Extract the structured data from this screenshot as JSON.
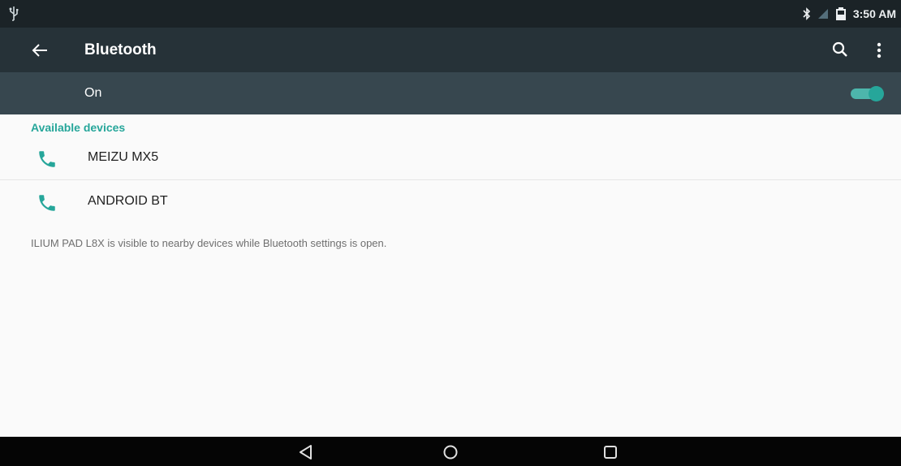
{
  "status_bar": {
    "time": "3:50 AM",
    "icons": [
      "usb-icon",
      "bluetooth-icon",
      "no-signal-icon",
      "battery-icon"
    ]
  },
  "toolbar": {
    "title": "Bluetooth",
    "icons": [
      "back-arrow-icon",
      "search-icon",
      "more-vert-icon"
    ]
  },
  "master_switch": {
    "label": "On",
    "state": "on",
    "accent_color": "#26a69a"
  },
  "available_devices": {
    "header": "Available devices",
    "items": [
      {
        "name": "MEIZU MX5",
        "icon": "phone-icon"
      },
      {
        "name": "ANDROID BT",
        "icon": "phone-icon"
      }
    ]
  },
  "footer_note": "ILIUM PAD L8X is visible to nearby devices while Bluetooth settings is open.",
  "nav_bar": {
    "icons": [
      "back-triangle-icon",
      "home-circle-icon",
      "recents-square-icon"
    ]
  },
  "colors": {
    "status_bar": "#1b2327",
    "toolbar": "#263238",
    "switch_bar": "#37474f",
    "accent": "#26a69a",
    "background": "#fafafa"
  }
}
